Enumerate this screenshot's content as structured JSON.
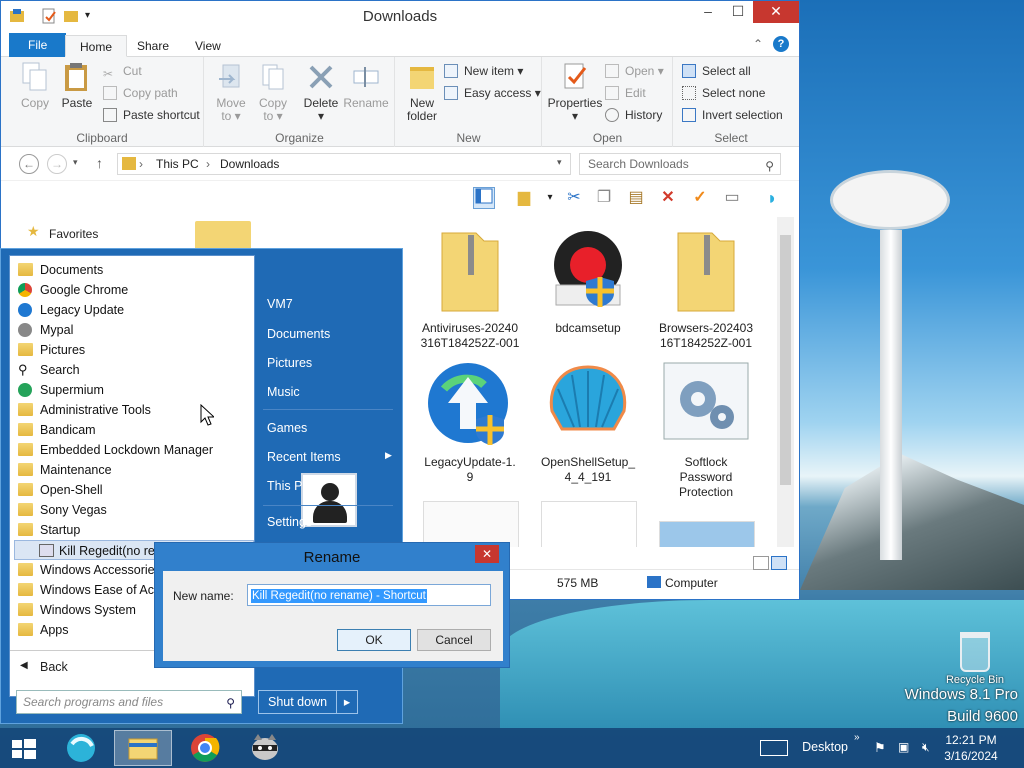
{
  "desktop": {
    "os_line1": "Windows 8.1 Pro",
    "os_line2": "Build 9600",
    "recycle_bin_label": "Recycle Bin"
  },
  "explorer": {
    "title": "Downloads",
    "window_buttons": [
      "–",
      "☐",
      "✕"
    ],
    "tabs": {
      "file": "File",
      "home": "Home",
      "share": "Share",
      "view": "View"
    },
    "ribbon": {
      "clipboard": {
        "label": "Clipboard",
        "copy": "Copy",
        "paste": "Paste",
        "cut": "Cut",
        "copy_path": "Copy path",
        "paste_shortcut": "Paste shortcut"
      },
      "organize": {
        "label": "Organize",
        "move_to": "Move",
        "move_to2": "to ▾",
        "copy_to": "Copy",
        "copy_to2": "to ▾",
        "delete": "Delete",
        "delete2": "▾",
        "rename": "Rename"
      },
      "new": {
        "label": "New",
        "new_folder": "New",
        "new_folder2": "folder",
        "new_item": "New item ▾",
        "easy_access": "Easy access ▾"
      },
      "open": {
        "label": "Open",
        "properties": "Properties",
        "properties2": "▾",
        "open": "Open ▾",
        "edit": "Edit",
        "history": "History"
      },
      "select": {
        "label": "Select",
        "select_all": "Select all",
        "select_none": "Select none",
        "invert": "Invert selection"
      }
    },
    "address": {
      "segments": [
        "This PC",
        "Downloads"
      ],
      "separator": "›"
    },
    "search_placeholder": "Search Downloads",
    "nav": {
      "favorites": "Favorites"
    },
    "files": [
      {
        "name": "Antiviruses-20240316T184252Z-001",
        "l1": "Antiviruses-20240",
        "l2": "316T184252Z-001"
      },
      {
        "name": "bdcamsetup",
        "l1": "bdcamsetup",
        "l2": ""
      },
      {
        "name": "Browsers-20240316T184252Z-001",
        "l1": "Browsers-202403",
        "l2": "16T184252Z-001"
      },
      {
        "name": "LegacyUpdate-1.9",
        "l1": "LegacyUpdate-1.",
        "l2": "9"
      },
      {
        "name": "OpenShellSetup_4_4_191",
        "l1": "OpenShellSetup_",
        "l2": "4_4_191"
      },
      {
        "name": "Softlock Password Protection",
        "l1": "Softlock",
        "l2": "Password",
        "l3": "Protection"
      }
    ],
    "status": {
      "size": "575 MB",
      "location": "Computer"
    }
  },
  "start_menu": {
    "programs": [
      {
        "label": "Documents"
      },
      {
        "label": "Google Chrome"
      },
      {
        "label": "Legacy Update"
      },
      {
        "label": "Mypal"
      },
      {
        "label": "Pictures"
      },
      {
        "label": "Search"
      },
      {
        "label": "Supermium"
      },
      {
        "label": "Administrative Tools"
      },
      {
        "label": "Bandicam"
      },
      {
        "label": "Embedded Lockdown Manager"
      },
      {
        "label": "Maintenance"
      },
      {
        "label": "Open-Shell"
      },
      {
        "label": "Sony Vegas"
      },
      {
        "label": "Startup"
      },
      {
        "label": "Kill Regedit(no rename) - Shortcut"
      },
      {
        "label": "Windows Accessories"
      },
      {
        "label": "Windows Ease of Access"
      },
      {
        "label": "Windows System"
      },
      {
        "label": "Apps"
      }
    ],
    "back": "Back",
    "search_placeholder": "Search programs and files",
    "places": {
      "user": "VM7",
      "documents": "Documents",
      "pictures": "Pictures",
      "music": "Music",
      "games": "Games",
      "recent_items": "Recent Items",
      "this_pc": "This PC",
      "settings": "Settings"
    },
    "shutdown": "Shut down"
  },
  "rename_dialog": {
    "title": "Rename",
    "new_name_label": "New name:",
    "value": "Kill Regedit(no rename) - Shortcut",
    "ok": "OK",
    "cancel": "Cancel"
  },
  "taskbar": {
    "desktop_label": "Desktop",
    "time": "12:21 PM",
    "date": "3/16/2024"
  },
  "colors": {
    "accent": "#1979ca",
    "start_bg": "#1f6ab5",
    "close_red": "#c7372f"
  }
}
